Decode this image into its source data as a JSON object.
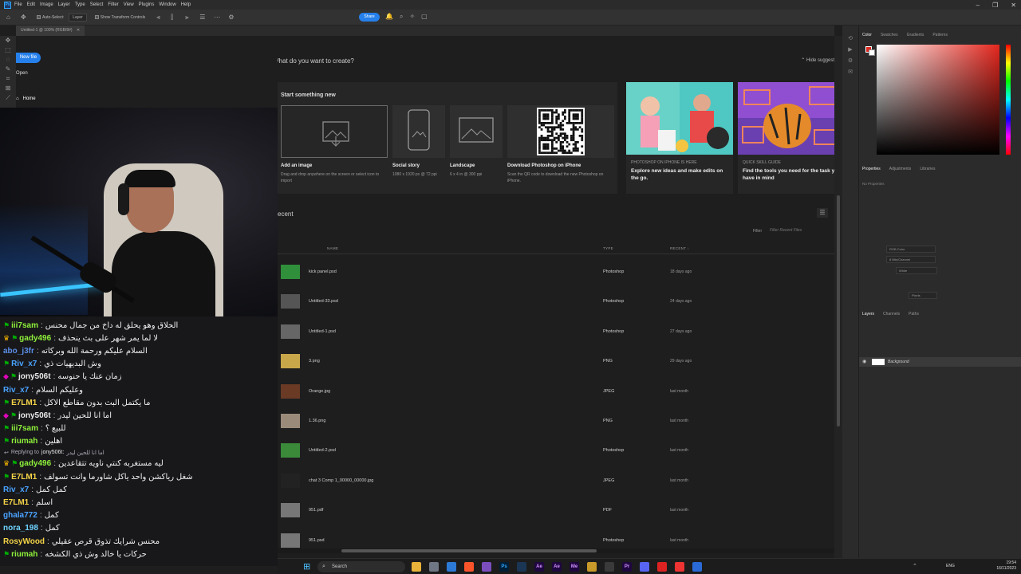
{
  "menubar": {
    "logo": "Ps",
    "items": [
      "File",
      "Edit",
      "Image",
      "Layer",
      "Type",
      "Select",
      "Filter",
      "View",
      "Plugins",
      "Window",
      "Help"
    ]
  },
  "options_bar": {
    "auto_select_label": "Auto-Select:",
    "auto_select_value": "Layer",
    "transform_controls": "Show Transform Controls",
    "share_label": "Share"
  },
  "document_tab": "Untitled-1 @ 100% (RGB/8#)",
  "home": {
    "new_file": "New file",
    "open": "Open",
    "home": "Home",
    "what_title": "What do you want to create?",
    "hide_suggestions": "Hide suggest",
    "start_title": "Start something new",
    "presets": [
      {
        "label": "Add an image",
        "sub": "Drag and drop anywhere on the screen or select icon to import"
      },
      {
        "label": "Social story",
        "sub": "1080 x 1920 px @ 72 ppi"
      },
      {
        "label": "Landscape",
        "sub": "6 x 4 in @ 300 ppi"
      },
      {
        "label": "Download Photoshop on iPhone",
        "sub": "Scan the QR code to download the new Photoshop on iPhone."
      }
    ],
    "promos": [
      {
        "eyebrow": "PHOTOSHOP ON IPHONE IS HERE",
        "text": "Explore new ideas and make edits on the go."
      },
      {
        "eyebrow": "QUICK SKILL GUIDE",
        "text": "Find the tools you need for the task you have in mind"
      }
    ],
    "recent_title": "ecent",
    "filter_label": "Filter",
    "filter_placeholder": "Filter Recent Files",
    "columns": {
      "name": "NAME",
      "type": "TYPE",
      "recent": "RECENT"
    },
    "files": [
      {
        "name": "kick panel.psd",
        "type": "Photoshop",
        "date": "18 days ago"
      },
      {
        "name": "Untitled-33.psd",
        "type": "Photoshop",
        "date": "24 days ago"
      },
      {
        "name": "Untitled-1.psd",
        "type": "Photoshop",
        "date": "27 days ago"
      },
      {
        "name": "3.png",
        "type": "PNG",
        "date": "29 days ago"
      },
      {
        "name": "Orange.jpg",
        "type": "JPEG",
        "date": "last month"
      },
      {
        "name": "1.36.png",
        "type": "PNG",
        "date": "last month"
      },
      {
        "name": "Untitled-2.psd",
        "type": "Photoshop",
        "date": "last month"
      },
      {
        "name": "chat 3 Comp 1_00000_00000.jpg",
        "type": "JPEG",
        "date": "last month"
      },
      {
        "name": "951.pdf",
        "type": "PDF",
        "date": "last month"
      },
      {
        "name": "951.psd",
        "type": "Photoshop",
        "date": "last month"
      }
    ]
  },
  "chat": {
    "lines": [
      {
        "user": "iii7sam",
        "msg": "الحلاق وهو يحلق له داخ من جمال محنس",
        "color": "#8ef03a",
        "badges": [
          "mod"
        ]
      },
      {
        "user": "gady496",
        "msg": "لا لما يمر شهر على بث ينحذف",
        "color": "#8ef03a",
        "badges": [
          "crown",
          "mod"
        ]
      },
      {
        "user": "abo_j3fr",
        "msg": "السلام عليكم ورحمة الله وبركاته",
        "color": "#5b8ee6",
        "badges": []
      },
      {
        "user": "Riv_x7",
        "msg": "وش البديهيات ذي",
        "color": "#4aa3ff",
        "badges": [
          "mod"
        ]
      },
      {
        "user": "jony506t",
        "msg": "زمان عنك يا حنوسه",
        "color": "#e8e8e8",
        "badges": [
          "vip",
          "mod"
        ]
      },
      {
        "user": "Riv_x7",
        "msg": "وعليكم السلام",
        "color": "#4aa3ff",
        "badges": []
      },
      {
        "user": "E7LM1",
        "msg": "ما يكتمل البث بدون مقاطع الاكل",
        "color": "#f5d547",
        "badges": [
          "mod"
        ]
      },
      {
        "user": "jony506t",
        "msg": "اما انا للحين ليدر",
        "color": "#e8e8e8",
        "badges": [
          "vip",
          "mod"
        ]
      },
      {
        "user": "iii7sam",
        "msg": "للبيع ؟",
        "color": "#8ef03a",
        "badges": [
          "mod"
        ]
      },
      {
        "user": "riumah",
        "msg": "اهلين",
        "color": "#8ef03a",
        "badges": [
          "mod"
        ]
      }
    ],
    "reply": {
      "prefix": "Replying to",
      "user": "jony506t:",
      "msg": "اما انا للحين ليدر"
    },
    "lines2": [
      {
        "user": "gady496",
        "msg": "ليه مستغربه كنتي ناويه تتقاعدين",
        "color": "#8ef03a",
        "badges": [
          "crown",
          "mod"
        ]
      },
      {
        "user": "E7LM1",
        "msg": "شغل رياكشن واحد ياكل شاورما وانت تسولف",
        "color": "#f5d547",
        "badges": [
          "mod"
        ]
      },
      {
        "user": "Riv_x7",
        "msg": "كمل كمل",
        "color": "#4aa3ff",
        "badges": []
      },
      {
        "user": "E7LM1",
        "msg": "اسلم",
        "color": "#f5d547",
        "badges": []
      },
      {
        "user": "ghala772",
        "msg": "كمل",
        "color": "#4aa3ff",
        "badges": []
      },
      {
        "user": "nora_198",
        "msg": "كمل",
        "color": "#6fd3ff",
        "badges": []
      },
      {
        "user": "RosyWood",
        "msg": "محنس شرايك تذوق قرص عقيلي",
        "color": "#f5d547",
        "badges": []
      },
      {
        "user": "riumah",
        "msg": "حركات يا خالد وش ذي الكشخه",
        "color": "#8ef03a",
        "badges": [
          "mod"
        ]
      }
    ]
  },
  "right_panel": {
    "color_tabs": [
      "Color",
      "Swatches",
      "Gradients",
      "Patterns"
    ],
    "props_tabs": [
      "Properties",
      "Adjustments",
      "Libraries"
    ],
    "no_properties": "No Properties",
    "mode_selects": [
      "RGB Color",
      "8 Bits/Channel",
      "White",
      "Pixels"
    ],
    "layer_tabs": [
      "Layers",
      "Channels",
      "Paths"
    ],
    "layer_name": "Background",
    "fg_color": "#e0271e"
  },
  "taskbar": {
    "search": "Search",
    "lang": "ENG",
    "time": "19:54",
    "date": "16/11/2023"
  }
}
